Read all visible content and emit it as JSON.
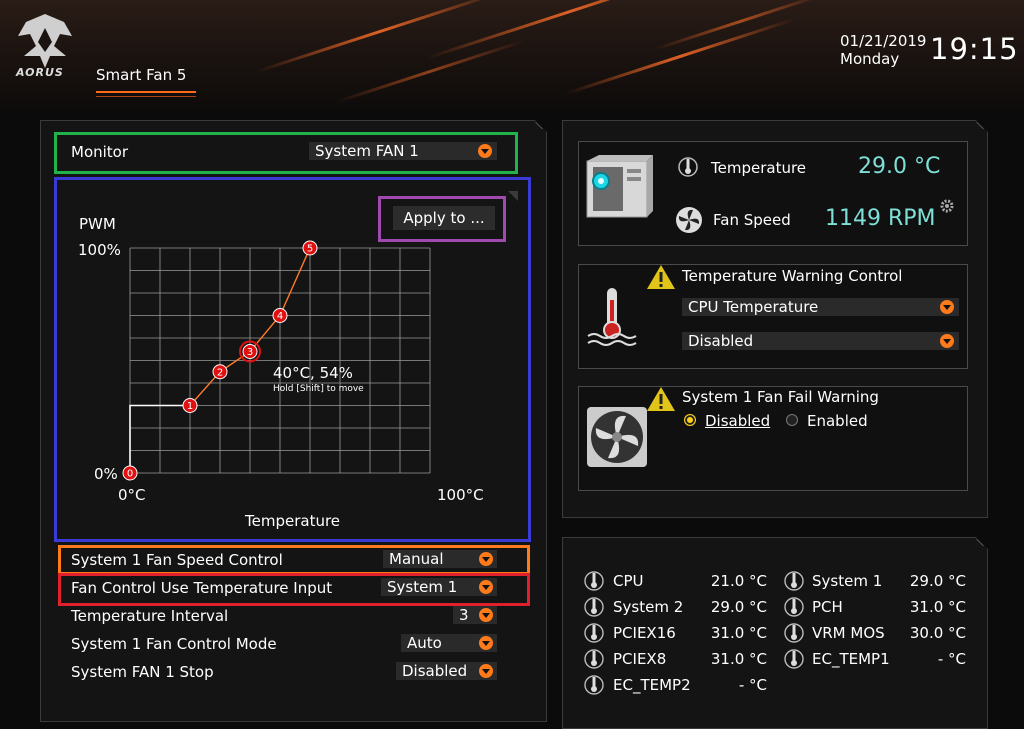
{
  "header": {
    "logo_text": "AORUS",
    "tab_label": "Smart Fan 5",
    "date": "01/21/2019",
    "day": "Monday",
    "time": "19:15"
  },
  "colors": {
    "accent": "#ff6a1a",
    "monitor_box": "#22b24c",
    "graph_box": "#3a3ad6",
    "apply_box": "#a04ab0",
    "speed_box": "#ff7a1a",
    "temp_input_box": "#e0202c",
    "value_teal": "#7ee0d6",
    "point_red": "#e01010"
  },
  "monitor": {
    "label": "Monitor",
    "selected": "System FAN 1"
  },
  "graph": {
    "y_title": "PWM",
    "y_max_label": "100%",
    "y_min_label": "0%",
    "x_min_label": "0°C",
    "x_max_label": "100°C",
    "x_title": "Temperature",
    "apply_label": "Apply to ...",
    "tooltip_value": "40°C, 54%",
    "tooltip_hint": "Hold [Shift] to move"
  },
  "chart_data": {
    "type": "line",
    "xlabel": "Temperature",
    "ylabel": "PWM",
    "xlim": [
      0,
      100
    ],
    "ylim": [
      0,
      100
    ],
    "grid": true,
    "points": [
      {
        "label": "0",
        "x": 0,
        "y": 0
      },
      {
        "label": "1",
        "x": 20,
        "y": 30
      },
      {
        "label": "2",
        "x": 30,
        "y": 45
      },
      {
        "label": "3",
        "x": 40,
        "y": 54
      },
      {
        "label": "4",
        "x": 50,
        "y": 70
      },
      {
        "label": "5",
        "x": 60,
        "y": 100
      }
    ],
    "selected_point": "3"
  },
  "settings": [
    {
      "label": "System 1 Fan Speed Control",
      "value": "Manual"
    },
    {
      "label": "Fan Control Use Temperature Input",
      "value": "System 1"
    },
    {
      "label": "Temperature Interval",
      "value": "3"
    },
    {
      "label": "System 1 Fan Control Mode",
      "value": "Auto"
    },
    {
      "label": "System FAN 1 Stop",
      "value": "Disabled"
    }
  ],
  "status": {
    "temp_label": "Temperature",
    "temp_value": "29.0 °C",
    "fan_label": "Fan Speed",
    "fan_value": "1149 RPM"
  },
  "temp_warning": {
    "title": "Temperature Warning Control",
    "source": "CPU Temperature",
    "value": "Disabled"
  },
  "fan_fail": {
    "title": "System 1 Fan Fail Warning",
    "opt_disabled": "Disabled",
    "opt_enabled": "Enabled",
    "selected": "Disabled"
  },
  "sensors": [
    {
      "name": "CPU",
      "value": "21.0 °C"
    },
    {
      "name": "System 1",
      "value": "29.0 °C"
    },
    {
      "name": "System 2",
      "value": "29.0 °C"
    },
    {
      "name": "PCH",
      "value": "31.0 °C"
    },
    {
      "name": "PCIEX16",
      "value": "31.0 °C"
    },
    {
      "name": "VRM MOS",
      "value": "30.0 °C"
    },
    {
      "name": "PCIEX8",
      "value": "31.0 °C"
    },
    {
      "name": "EC_TEMP1",
      "value": "- °C"
    },
    {
      "name": "EC_TEMP2",
      "value": "- °C"
    }
  ]
}
